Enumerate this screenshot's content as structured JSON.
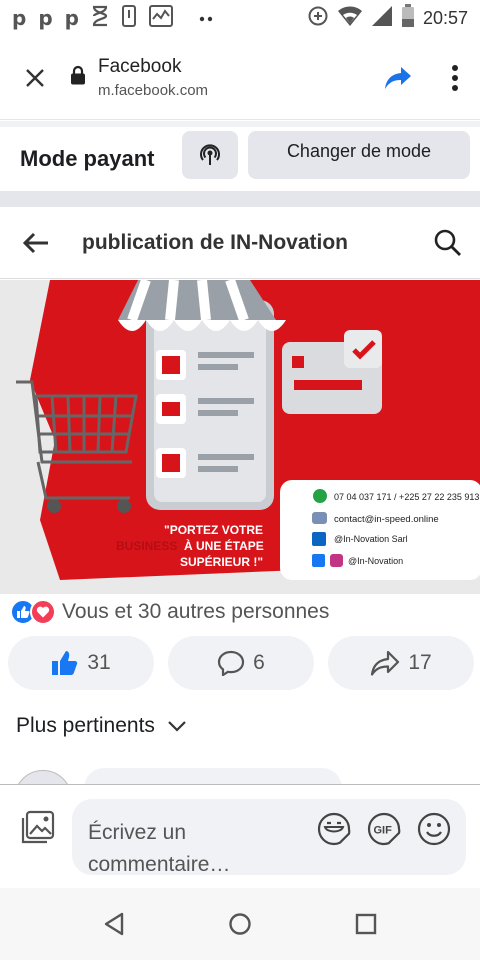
{
  "status_bar": {
    "icons": [
      "p-icon",
      "p-icon",
      "p-icon",
      "hourglass-icon",
      "phone-icon",
      "chart-icon",
      "more-dots-icon",
      "data-saver-icon",
      "wifi-icon",
      "signal-icon",
      "battery-icon"
    ],
    "time": "20:57"
  },
  "browser": {
    "title": "Facebook",
    "host": "m.facebook.com"
  },
  "mode": {
    "label": "Mode payant",
    "change_button": "Changer de mode"
  },
  "header": {
    "title": "publication de IN-Novation"
  },
  "post_image": {
    "slogan_line1": "\"PORTEZ VOTRE",
    "slogan_line2_word": "BUSINESS",
    "slogan_line2_rest": "À UNE ÉTAPE",
    "slogan_line3": "SUPÉRIEUR !\"",
    "phone": "07 04 037 171 / +225 27 22 235 913",
    "email": "contact@in-speed.online",
    "linkedin": "@In-Novation Sarl",
    "social": "@In-Novation"
  },
  "reactions": {
    "text": "Vous et 30 autres personnes"
  },
  "actions": {
    "likes": "31",
    "comments": "6",
    "shares": "17"
  },
  "sort": {
    "label": "Plus pertinents"
  },
  "composer": {
    "placeholder": "Écrivez un commentaire…"
  },
  "colors": {
    "accent_blue": "#1877f2",
    "love_red": "#f33e58",
    "brand_red": "#d8141b"
  }
}
